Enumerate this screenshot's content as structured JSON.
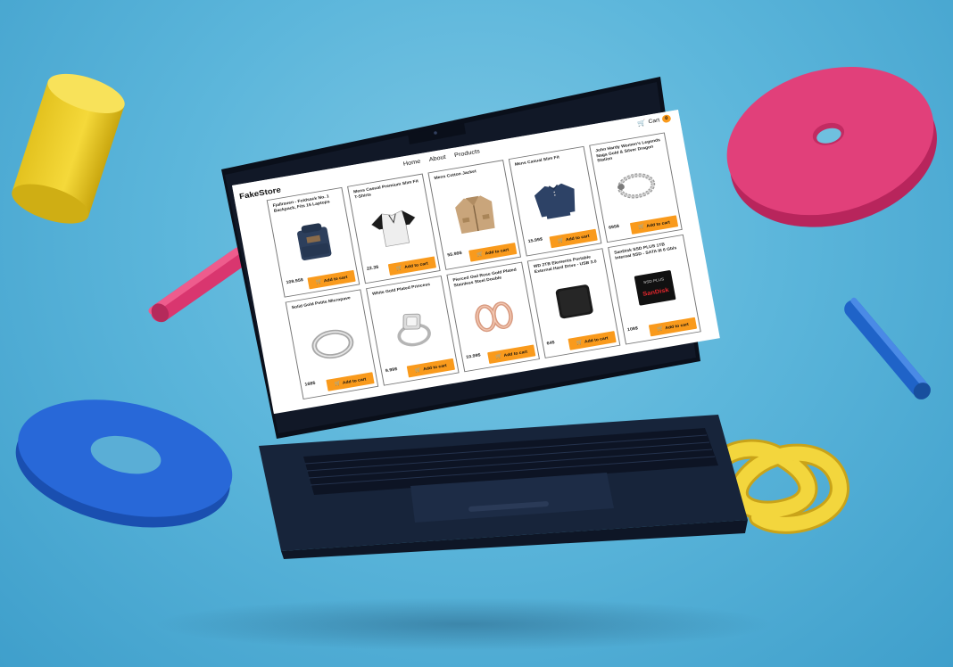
{
  "brand": "FakeStore",
  "nav": [
    "Home",
    "About",
    "Products"
  ],
  "cart": {
    "label": "Cart",
    "count": "0"
  },
  "products": [
    {
      "title": "Fjallraven - Foldsack No. 1 Backpack, Fits 15 Laptops",
      "price": "109.95$",
      "button": "Add to cart",
      "icon": "backpack-image"
    },
    {
      "title": "Mens Casual Premium Slim Fit T-Shirts",
      "price": "22.3$",
      "button": "Add to cart",
      "icon": "tshirt-image"
    },
    {
      "title": "Mens Cotton Jacket",
      "price": "55.99$",
      "button": "Add to cart",
      "icon": "jacket-image"
    },
    {
      "title": "Mens Casual Slim Fit",
      "price": "15.99$",
      "button": "Add to cart",
      "icon": "sweater-image"
    },
    {
      "title": "John Hardy Women's Legends Naga Gold & Silver Dragon Station",
      "price": "695$",
      "button": "Add to cart",
      "icon": "bracelet-image"
    },
    {
      "title": "Solid Gold Petite Micropave",
      "price": "168$",
      "button": "Add to cart",
      "icon": "ring-image"
    },
    {
      "title": "White Gold Plated Princess",
      "price": "9.99$",
      "button": "Add to cart",
      "icon": "diamond-ring-image"
    },
    {
      "title": "Pierced Owl Rose Gold Plated Stainless Steel Double",
      "price": "10.99$",
      "button": "Add to cart",
      "icon": "rose-gold-rings-image"
    },
    {
      "title": "WD 2TB Elements Portable External Hard Drive - USB 3.0",
      "price": "64$",
      "button": "Add to cart",
      "icon": "hard-drive-image"
    },
    {
      "title": "SanDisk SSD PLUS 1TB Internal SSD - SATA III 6 Gb/s",
      "price": "109$",
      "button": "Add to cart",
      "icon": "ssd-image",
      "image_text": [
        "SSD PLUS",
        "SanDisk"
      ]
    }
  ],
  "colors": {
    "accent": "#f99a1c",
    "background": "#5cb6db"
  }
}
